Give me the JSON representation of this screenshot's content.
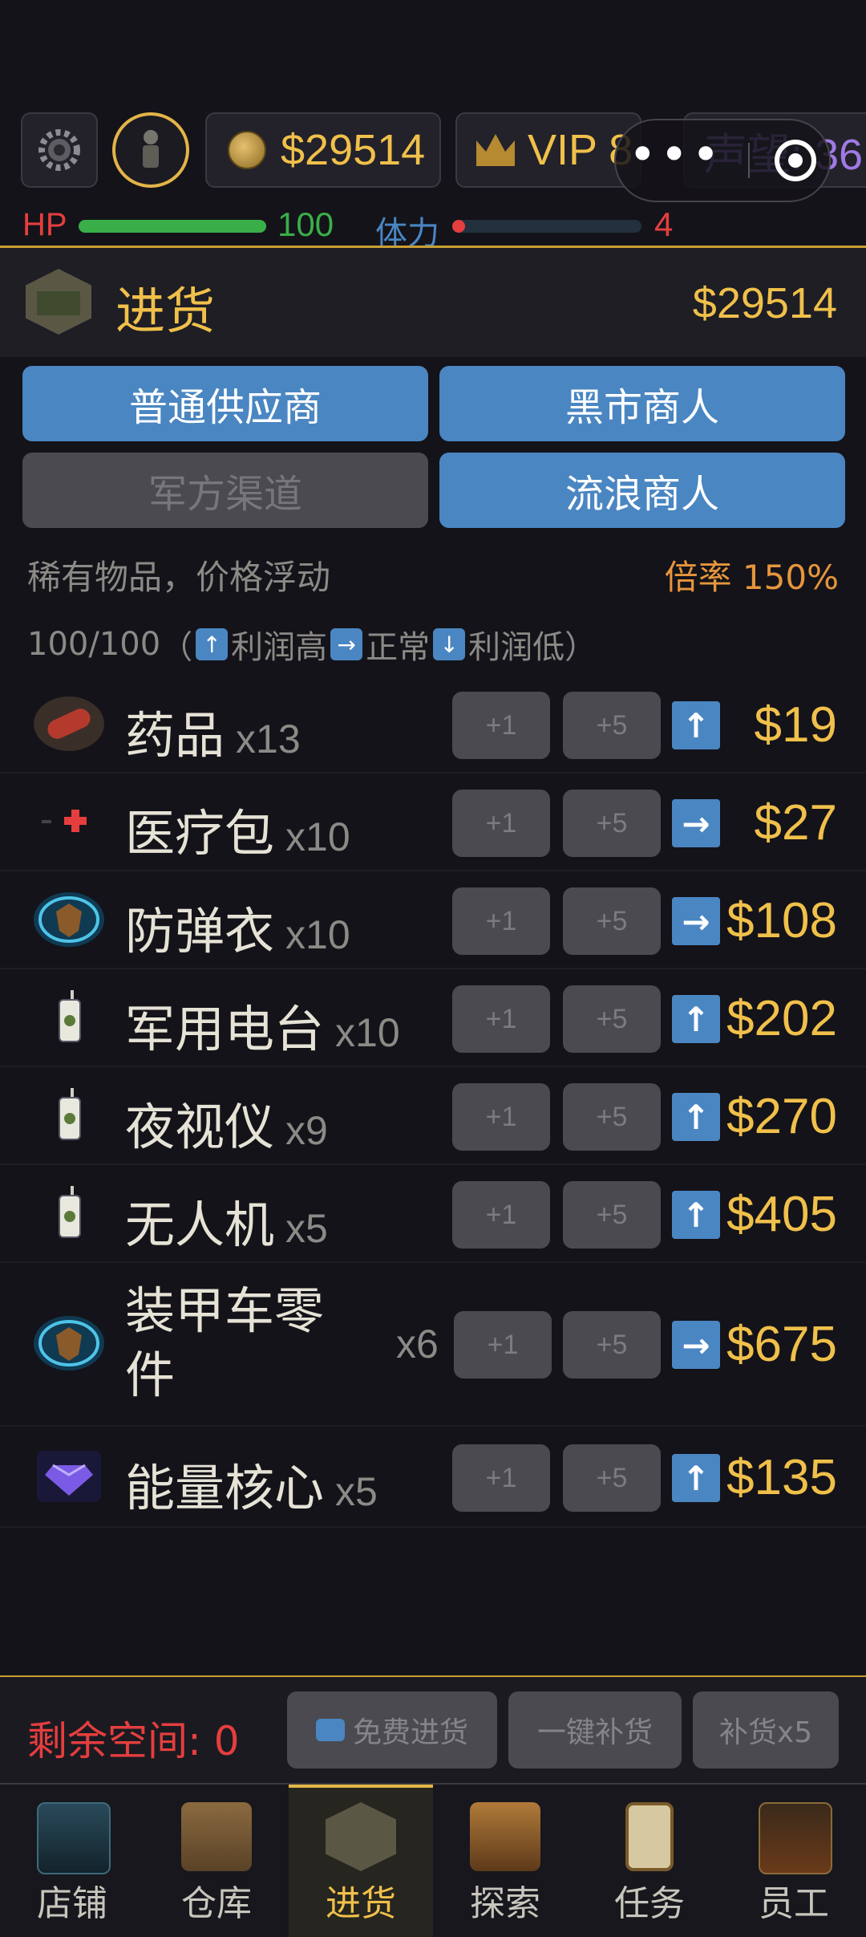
{
  "topbar": {
    "money": "$29514",
    "vip": "VIP 8",
    "reputation": "声望: 36",
    "capsule_dots": "•••"
  },
  "stats": {
    "hp_label": "HP",
    "hp_value": "100",
    "hp_fraction": 1.0,
    "stamina_label": "体力",
    "stamina_value": "4",
    "stamina_fraction": 0.04
  },
  "header": {
    "title": "进货",
    "money": "$29514"
  },
  "suppliers": [
    {
      "label": "普通供应商",
      "active": true
    },
    {
      "label": "黑市商人",
      "active": true
    },
    {
      "label": "军方渠道",
      "active": false
    },
    {
      "label": "流浪商人",
      "active": true
    }
  ],
  "info": {
    "description": "稀有物品，价格浮动",
    "rate": "倍率 150%",
    "capacity": "100/100",
    "legend_open": "（",
    "legend_high": "利润高",
    "legend_normal": "正常",
    "legend_low": "利润低",
    "legend_close": "）"
  },
  "items": [
    {
      "name": "药品",
      "qty": "x13",
      "btn1": "+1",
      "btn5": "+5",
      "trend": "up",
      "trend_icon": "arrow-up-icon",
      "price": "$19",
      "icon": "pill-icon"
    },
    {
      "name": "医疗包",
      "qty": "x10",
      "btn1": "+1",
      "btn5": "+5",
      "trend": "normal",
      "trend_icon": "arrow-right-icon",
      "price": "$27",
      "icon": "medkit-icon"
    },
    {
      "name": "防弹衣",
      "qty": "x10",
      "btn1": "+1",
      "btn5": "+5",
      "trend": "normal",
      "trend_icon": "arrow-right-icon",
      "price": "$108",
      "icon": "armor-badge-icon"
    },
    {
      "name": "军用电台",
      "qty": "x10",
      "btn1": "+1",
      "btn5": "+5",
      "trend": "up",
      "trend_icon": "arrow-up-icon",
      "price": "$202",
      "icon": "radio-icon"
    },
    {
      "name": "夜视仪",
      "qty": "x9",
      "btn1": "+1",
      "btn5": "+5",
      "trend": "up",
      "trend_icon": "arrow-up-icon",
      "price": "$270",
      "icon": "radio-icon"
    },
    {
      "name": "无人机",
      "qty": "x5",
      "btn1": "+1",
      "btn5": "+5",
      "trend": "up",
      "trend_icon": "arrow-up-icon",
      "price": "$405",
      "icon": "radio-icon"
    },
    {
      "name_line1": "装甲车零",
      "name_line2": "件",
      "qty": "x6",
      "btn1": "+1",
      "btn5": "+5",
      "trend": "normal",
      "trend_icon": "arrow-right-icon",
      "price": "$675",
      "icon": "armor-badge-icon"
    },
    {
      "name": "能量核心",
      "qty": "x5",
      "btn1": "+1",
      "btn5": "+5",
      "trend": "up",
      "trend_icon": "arrow-up-icon",
      "price": "$135",
      "icon": "gem-icon"
    }
  ],
  "footer": {
    "space": "剩余空间: 0",
    "free_restock": "免费进货",
    "one_click": "一键补货",
    "restock5": "补货x5"
  },
  "nav": [
    {
      "label": "店铺",
      "icon": "shop-icon",
      "active": false
    },
    {
      "label": "仓库",
      "icon": "warehouse-crate-icon",
      "active": false
    },
    {
      "label": "进货",
      "icon": "truck-icon",
      "active": true
    },
    {
      "label": "探索",
      "icon": "map-icon",
      "active": false
    },
    {
      "label": "任务",
      "icon": "clipboard-icon",
      "active": false
    },
    {
      "label": "员工",
      "icon": "team-icon",
      "active": false
    }
  ],
  "colors": {
    "accent_gold": "#f0c04a",
    "button_blue": "#4a86c2",
    "hp_green": "#3aae49",
    "stamina_red": "#e53e3e",
    "reputation_purple": "#9f7ae6"
  }
}
